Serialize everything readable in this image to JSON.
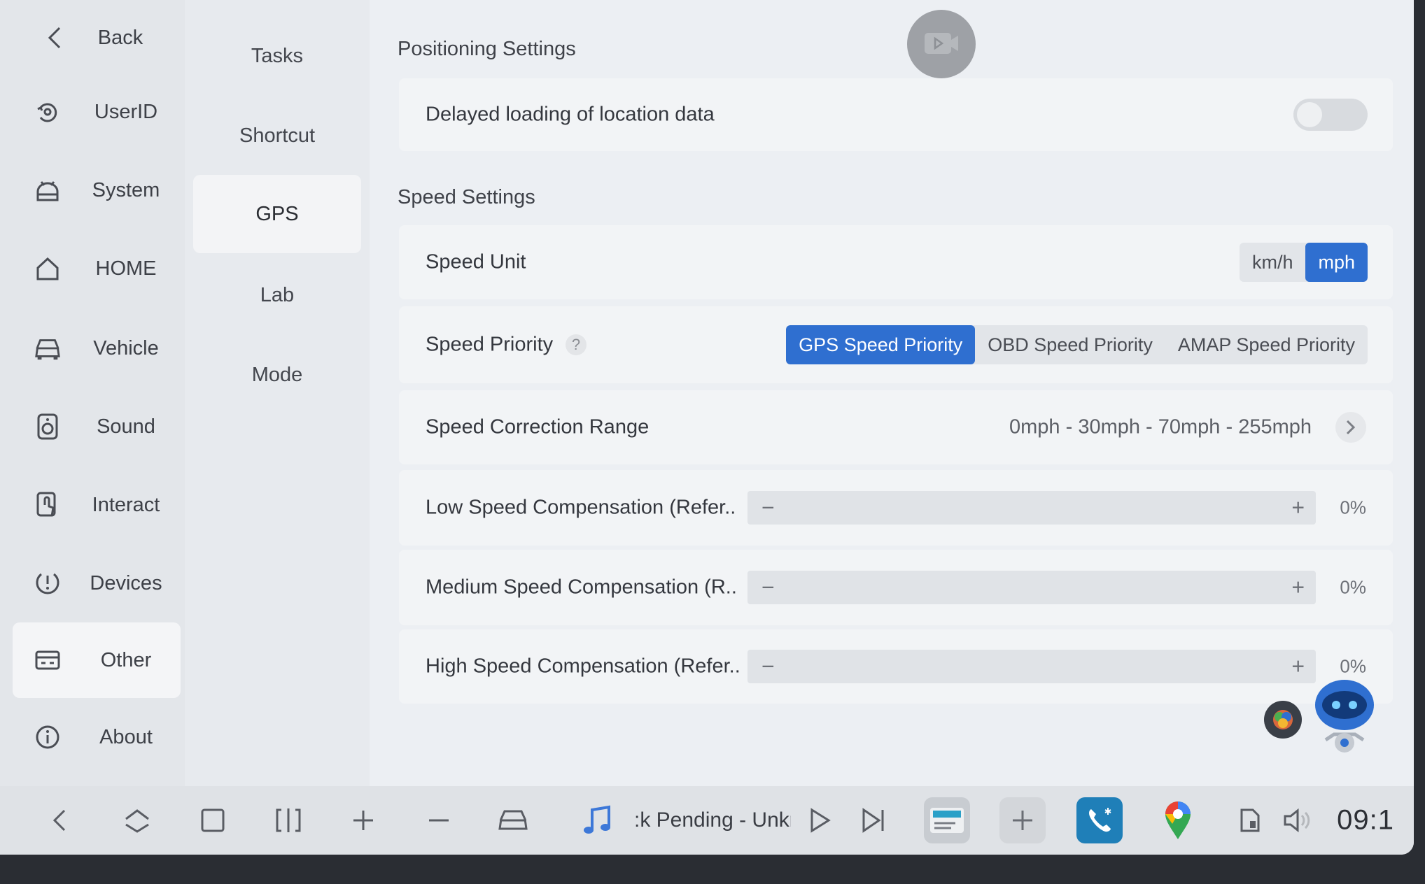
{
  "sidebar": {
    "back_label": "Back",
    "items": [
      {
        "label": "UserID",
        "icon": "user-id-icon"
      },
      {
        "label": "System",
        "icon": "android-icon"
      },
      {
        "label": "HOME",
        "icon": "home-icon"
      },
      {
        "label": "Vehicle",
        "icon": "car-icon"
      },
      {
        "label": "Sound",
        "icon": "speaker-icon"
      },
      {
        "label": "Interact",
        "icon": "touch-icon"
      },
      {
        "label": "Devices",
        "icon": "devices-icon"
      },
      {
        "label": "Other",
        "icon": "other-icon"
      },
      {
        "label": "About",
        "icon": "info-icon"
      }
    ],
    "active": "Other"
  },
  "submenu": {
    "items": [
      "Tasks",
      "Shortcut",
      "GPS",
      "Lab",
      "Mode"
    ],
    "active": "GPS"
  },
  "positioning": {
    "title": "Positioning Settings",
    "delayed_label": "Delayed loading of location data",
    "delayed_enabled": false
  },
  "speed": {
    "title": "Speed Settings",
    "unit_label": "Speed Unit",
    "unit_options": [
      "km/h",
      "mph"
    ],
    "unit_selected": "mph",
    "priority_label": "Speed Priority",
    "priority_help": "?",
    "priority_options": [
      "GPS Speed Priority",
      "OBD Speed Priority",
      "AMAP Speed Priority"
    ],
    "priority_selected": "GPS Speed Priority",
    "range_label": "Speed Correction Range",
    "range_value": "0mph - 30mph - 70mph - 255mph",
    "compensations": [
      {
        "label": "Low Speed Compensation (Refer..",
        "value": "0%"
      },
      {
        "label": "Medium Speed Compensation (R..",
        "value": "0%"
      },
      {
        "label": "High Speed Compensation (Refer..",
        "value": "0%"
      }
    ],
    "minus": "−",
    "plus": "+"
  },
  "taskbar": {
    "media_text": ":k Pending - Unkr",
    "clock": "09:1",
    "colors": {
      "phone": "#1f7fb8",
      "accent": "#2f6fd0"
    }
  }
}
